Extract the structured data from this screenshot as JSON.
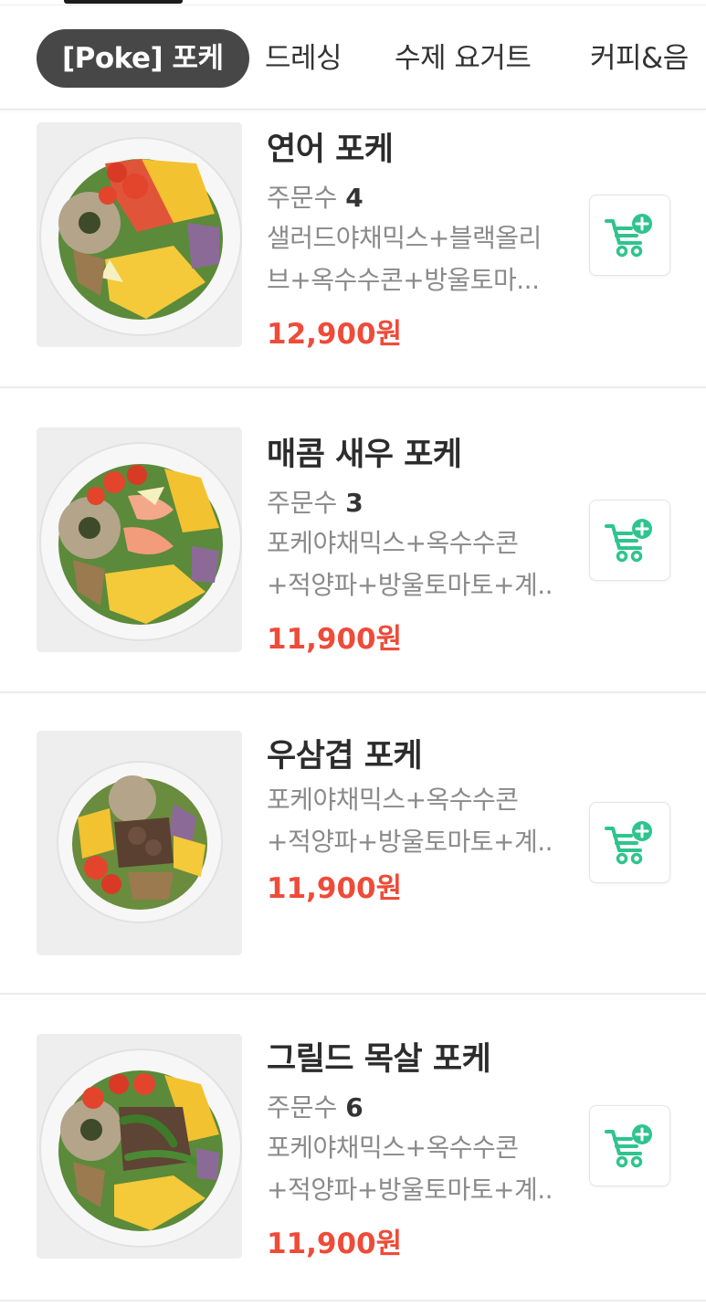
{
  "colors": {
    "active_tab_bg": "#474747",
    "price": "#ee4b39",
    "cart_icon": "#2fc48e",
    "divider": "#ececec"
  },
  "categories": [
    {
      "label": "[Poke] 포케",
      "active": true
    },
    {
      "label": "드레싱",
      "active": false
    },
    {
      "label": "수제 요거트",
      "active": false
    },
    {
      "label": "커피&음",
      "active": false
    }
  ],
  "order_count_label": "주문수",
  "items": [
    {
      "name": "연어 포케",
      "order_count": "4",
      "desc_line1": "샐러드야채믹스+블랙올리",
      "desc_line2": "브+옥수수콘+방울토마...",
      "price": "12,900원",
      "icon": "salmon-poke-bowl-photo"
    },
    {
      "name": "매콤 새우 포케",
      "order_count": "3",
      "desc_line1": "포케야채믹스+옥수수콘",
      "desc_line2": "+적양파+방울토마토+계...",
      "price": "11,900원",
      "icon": "shrimp-poke-bowl-photo"
    },
    {
      "name": "우삼겹 포케",
      "desc_line1": "포케야채믹스+옥수수콘",
      "desc_line2": "+적양파+방울토마토+계...",
      "price": "11,900원",
      "icon": "beef-poke-bowl-photo"
    },
    {
      "name": "그릴드 목살 포케",
      "order_count": "6",
      "desc_line1": "포케야채믹스+옥수수콘",
      "desc_line2": "+적양파+방울토마토+계...",
      "price": "11,900원",
      "icon": "pork-neck-poke-bowl-photo"
    }
  ],
  "cart_icon_name": "cart-plus-icon"
}
